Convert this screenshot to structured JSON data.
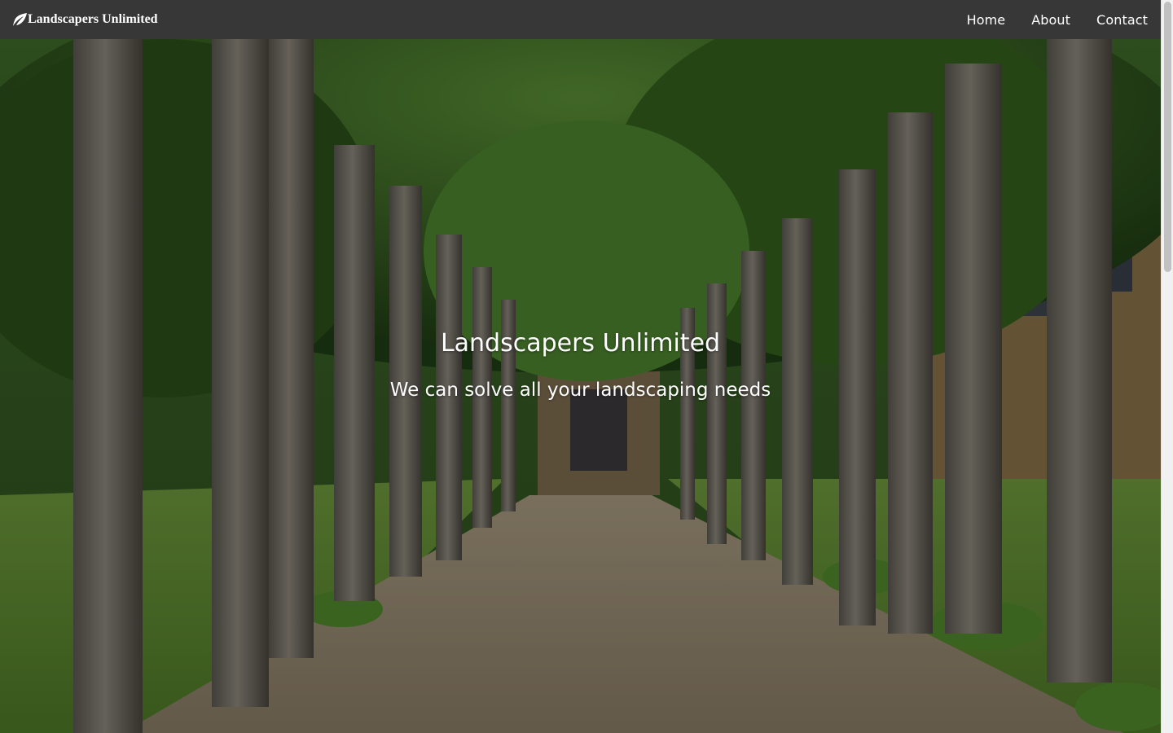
{
  "navbar": {
    "brand": "Landscapers Unlimited",
    "brand_icon": "leaf-icon",
    "links": [
      {
        "label": "Home"
      },
      {
        "label": "About"
      },
      {
        "label": "Contact"
      }
    ]
  },
  "hero": {
    "title": "Landscapers Unlimited",
    "subtitle": "We can solve all your landscaping needs",
    "background": "tree-lined gravel path leading to a stone manor"
  },
  "colors": {
    "navbar_bg": "#373737",
    "text": "#ffffff"
  }
}
